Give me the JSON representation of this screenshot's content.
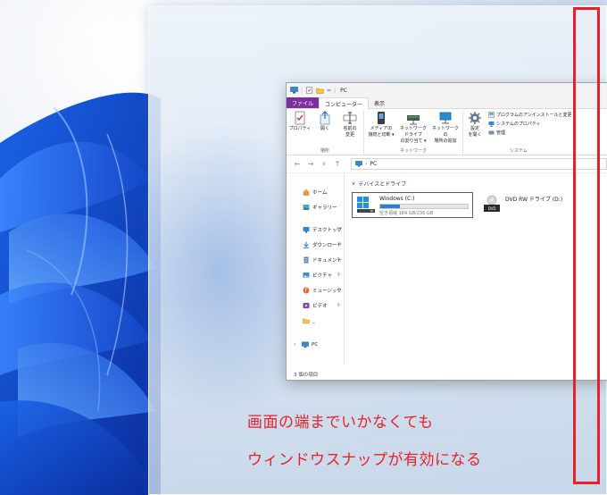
{
  "explorer": {
    "title": "PC",
    "tabs": [
      {
        "label": "ファイル"
      },
      {
        "label": "コンピューター"
      },
      {
        "label": "表示"
      }
    ],
    "ribbon": {
      "location_group": {
        "label": "場所",
        "buttons": [
          {
            "label": "プロパティ"
          },
          {
            "label": "開く"
          },
          {
            "label": "名前の\n変更"
          }
        ]
      },
      "network_group": {
        "label": "ネットワーク",
        "buttons": [
          {
            "label": "メディアの\n接続と切断 ▾"
          },
          {
            "label": "ネットワーク ドライブ\nの割り当て ▾"
          },
          {
            "label": "ネットワークの\n場所の追加"
          }
        ]
      },
      "system_group": {
        "label": "システム",
        "settings_label": "設定\nを開く",
        "items": [
          {
            "label": "プログラムのアンインストールと変更"
          },
          {
            "label": "システムのプロパティ"
          },
          {
            "label": "管理"
          }
        ]
      }
    },
    "address": {
      "path": "PC"
    },
    "nav_pane": {
      "top_items": [
        {
          "label": "ホーム"
        },
        {
          "label": "ギャラリー"
        }
      ],
      "pinned_items": [
        {
          "label": "デスクトップ"
        },
        {
          "label": "ダウンロード"
        },
        {
          "label": "ドキュメント"
        },
        {
          "label": "ピクチャ"
        },
        {
          "label": "ミュージック"
        },
        {
          "label": "ビデオ"
        },
        {
          "label": "_"
        }
      ],
      "pc_item": {
        "label": "PC"
      }
    },
    "main": {
      "group_header": "デバイスとドライブ",
      "drives": [
        {
          "name": "Windows (C:)",
          "free_text": "空き領域 184 GB/236 GB",
          "used_fraction": 0.22
        },
        {
          "name": "DVD RW ドライブ (D:)"
        }
      ]
    },
    "status": "3 個の項目"
  },
  "caption": {
    "line1": "画面の端までいかなくても",
    "line2": "ウィンドウスナップが有効になる"
  },
  "colors": {
    "accent_red": "#e8202a",
    "file_tab": "#7b2fa0",
    "drive_bar": "#2a7fd6"
  }
}
